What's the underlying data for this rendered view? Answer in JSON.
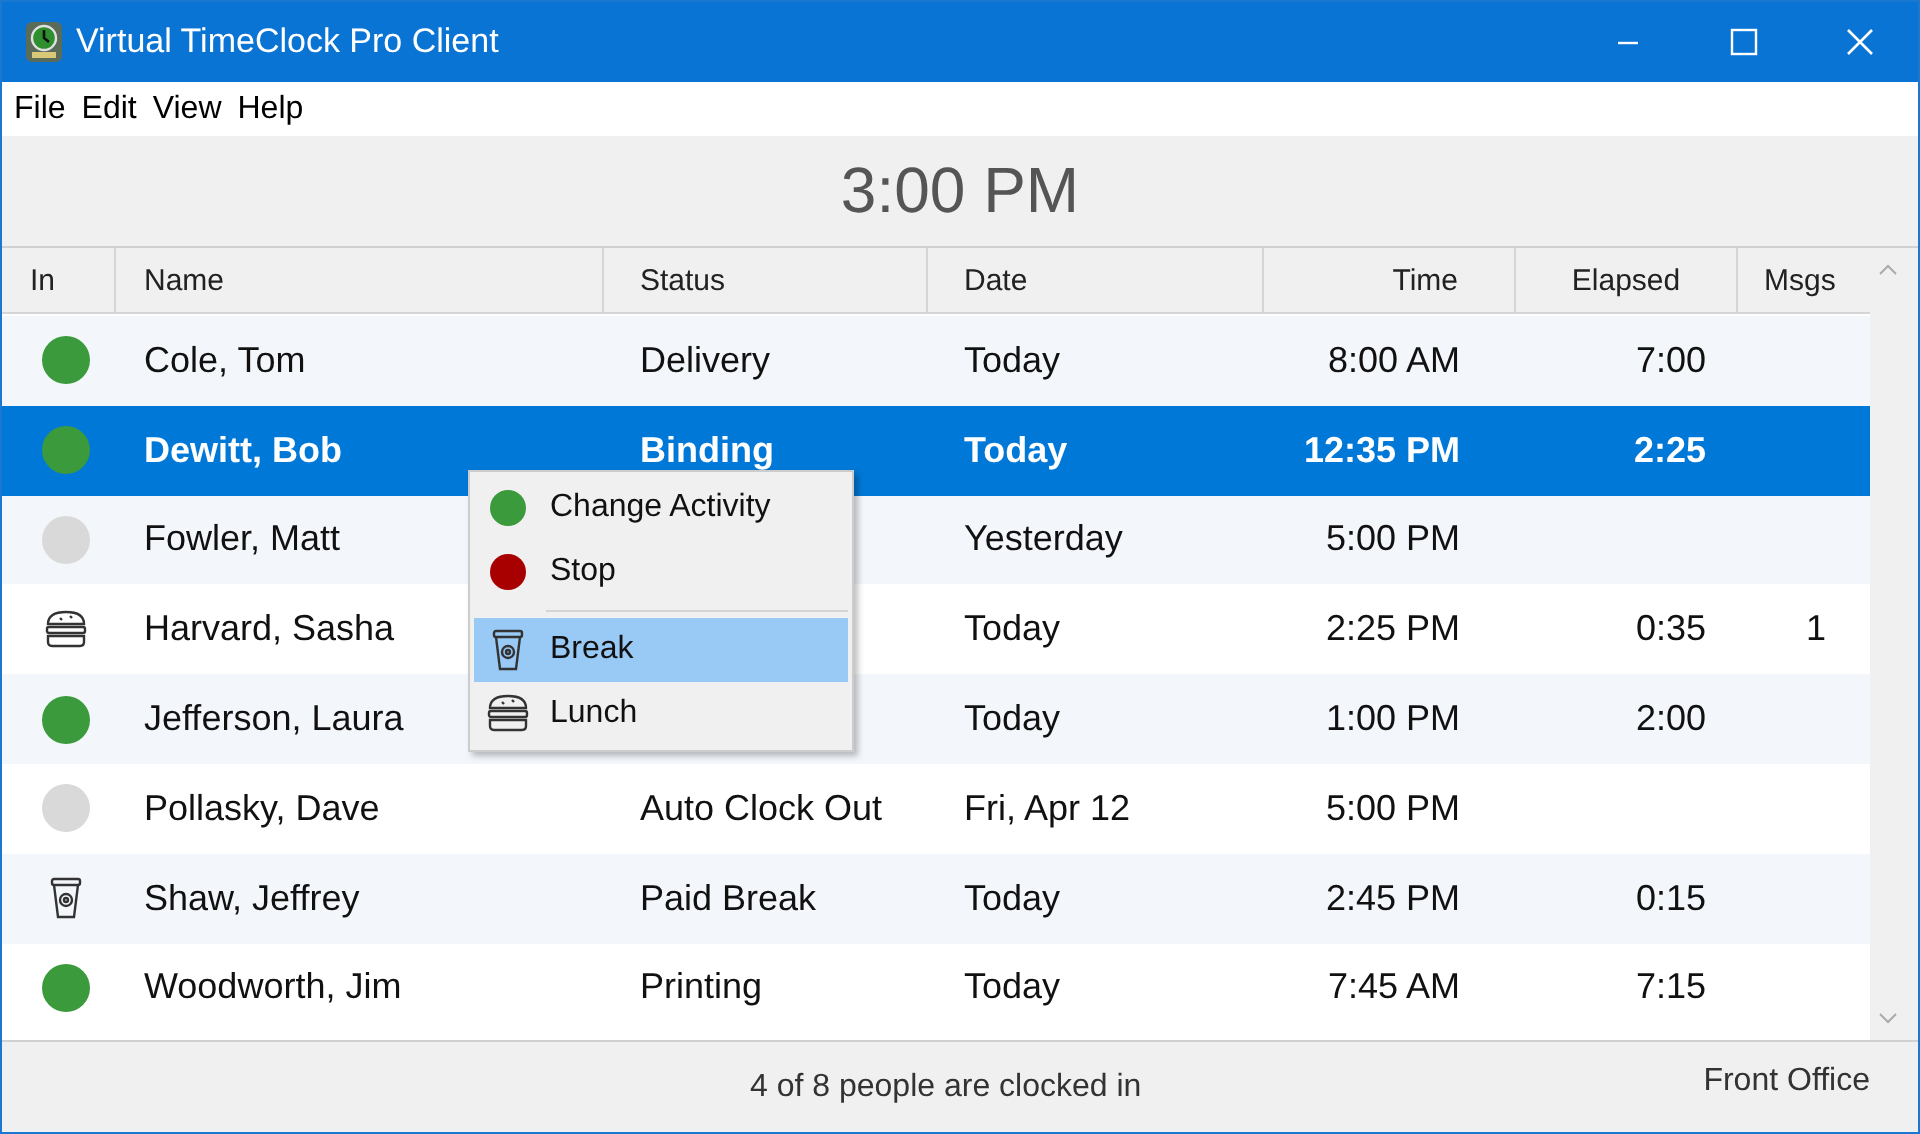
{
  "window": {
    "title": "Virtual TimeClock Pro Client"
  },
  "menu": [
    "File",
    "Edit",
    "View",
    "Help"
  ],
  "clock": "3:00 PM",
  "table": {
    "columns": [
      "In",
      "Name",
      "Status",
      "Date",
      "Time",
      "Elapsed",
      "Msgs"
    ],
    "rows": [
      {
        "indicator": {
          "kind": "dot",
          "color": "#3b9a3b"
        },
        "name": "Cole, Tom",
        "status": "Delivery",
        "date": "Today",
        "time": "8:00 AM",
        "elapsed": "7:00",
        "msgs": "",
        "selected": false
      },
      {
        "indicator": {
          "kind": "dot",
          "color": "#3b9a3b"
        },
        "name": "Dewitt, Bob",
        "status": "Binding",
        "date": "Today",
        "time": "12:35 PM",
        "elapsed": "2:25",
        "msgs": "",
        "selected": true
      },
      {
        "indicator": {
          "kind": "dot",
          "color": "#d9d9d9"
        },
        "name": "Fowler, Matt",
        "status": "",
        "date": "Yesterday",
        "time": "5:00 PM",
        "elapsed": "",
        "msgs": "",
        "selected": false
      },
      {
        "indicator": {
          "kind": "lunch"
        },
        "name": "Harvard, Sasha",
        "status": "",
        "date": "Today",
        "time": "2:25 PM",
        "elapsed": "0:35",
        "msgs": "1",
        "selected": false
      },
      {
        "indicator": {
          "kind": "dot",
          "color": "#3b9a3b"
        },
        "name": "Jefferson, Laura",
        "status": "",
        "date": "Today",
        "time": "1:00 PM",
        "elapsed": "2:00",
        "msgs": "",
        "selected": false
      },
      {
        "indicator": {
          "kind": "dot",
          "color": "#d9d9d9"
        },
        "name": "Pollasky, Dave",
        "status": "Auto Clock Out",
        "date": "Fri, Apr 12",
        "time": "5:00 PM",
        "elapsed": "",
        "msgs": "",
        "selected": false
      },
      {
        "indicator": {
          "kind": "break"
        },
        "name": "Shaw, Jeffrey",
        "status": "Paid Break",
        "date": "Today",
        "time": "2:45 PM",
        "elapsed": "0:15",
        "msgs": "",
        "selected": false
      },
      {
        "indicator": {
          "kind": "dot",
          "color": "#3b9a3b"
        },
        "name": "Woodworth, Jim",
        "status": "Printing",
        "date": "Today",
        "time": "7:45 AM",
        "elapsed": "7:15",
        "msgs": "",
        "selected": false
      }
    ]
  },
  "context_menu": {
    "items": [
      {
        "kind": "dot",
        "color": "#3b9a3b",
        "label": "Change Activity",
        "selected": false
      },
      {
        "kind": "dot",
        "color": "#a80000",
        "label": "Stop",
        "selected": false
      },
      {
        "kind": "separator"
      },
      {
        "kind": "break",
        "label": "Break",
        "selected": true
      },
      {
        "kind": "lunch",
        "label": "Lunch",
        "selected": false
      }
    ]
  },
  "status_bar": {
    "summary": "4 of 8 people are clocked in",
    "location": "Front Office"
  }
}
